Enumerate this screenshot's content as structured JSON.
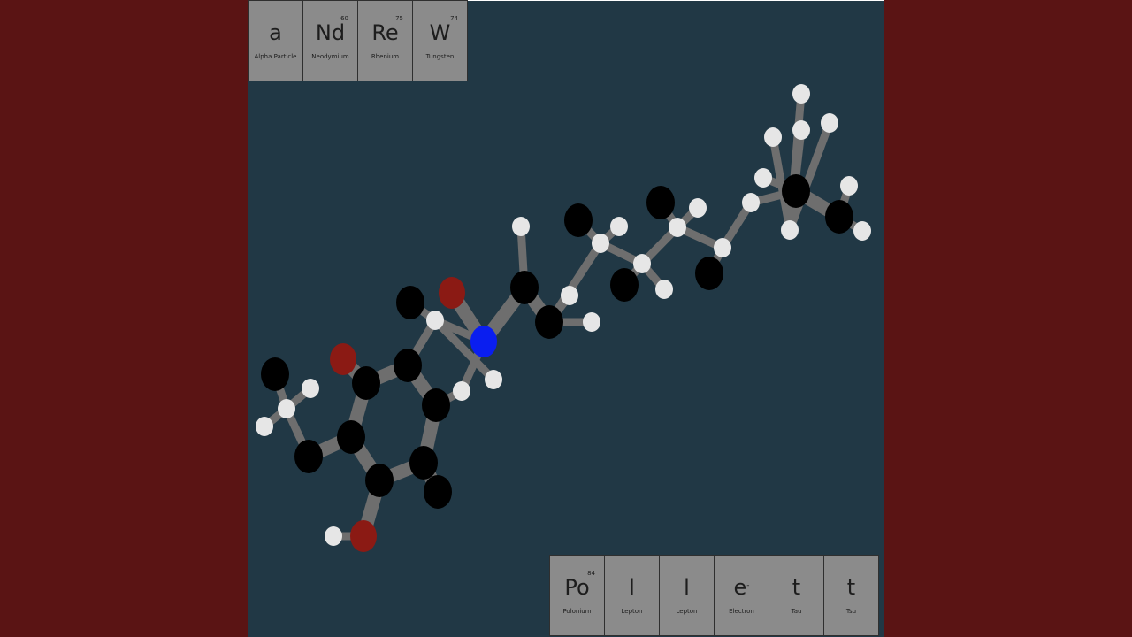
{
  "top_tiles": [
    {
      "symbol": "a",
      "number": "",
      "name": "Alpha Particle"
    },
    {
      "symbol": "Nd",
      "number": "60",
      "name": "Neodymium"
    },
    {
      "symbol": "Re",
      "number": "75",
      "name": "Rhenium"
    },
    {
      "symbol": "W",
      "number": "74",
      "name": "Tungsten"
    }
  ],
  "bottom_tiles": [
    {
      "symbol": "Po",
      "number": "84",
      "name": "Polonium"
    },
    {
      "symbol": "l",
      "number": "",
      "name": "Lepton"
    },
    {
      "symbol": "l",
      "number": "",
      "name": "Lepton"
    },
    {
      "symbol": "e",
      "superscript": "-",
      "number": "",
      "name": "Electron"
    },
    {
      "symbol": "t",
      "number": "",
      "name": "Tau"
    },
    {
      "symbol": "t",
      "number": "",
      "name": "Tsu"
    }
  ],
  "colors": {
    "background": "#5a1414",
    "stage": "#213845",
    "tile": "#8b8b8b",
    "carbon": "#000000",
    "hydrogen": "#e6e6e6",
    "oxygen": "#8b1a14",
    "nitrogen": "#0a1ef0",
    "bond": "#6e6e6e"
  },
  "molecule": {
    "atoms": [
      "C",
      "C",
      "C",
      "C",
      "C",
      "C",
      "C",
      "O",
      "O",
      "H",
      "C",
      "H",
      "H",
      "H",
      "C",
      "H",
      "H",
      "N",
      "H",
      "C",
      "O",
      "C",
      "H",
      "H",
      "C",
      "H",
      "H",
      "C",
      "H",
      "H",
      "C",
      "H",
      "H",
      "C",
      "H",
      "H",
      "C",
      "H",
      "C",
      "H",
      "H",
      "H",
      "C",
      "H",
      "H",
      "H",
      "H",
      "H"
    ]
  }
}
